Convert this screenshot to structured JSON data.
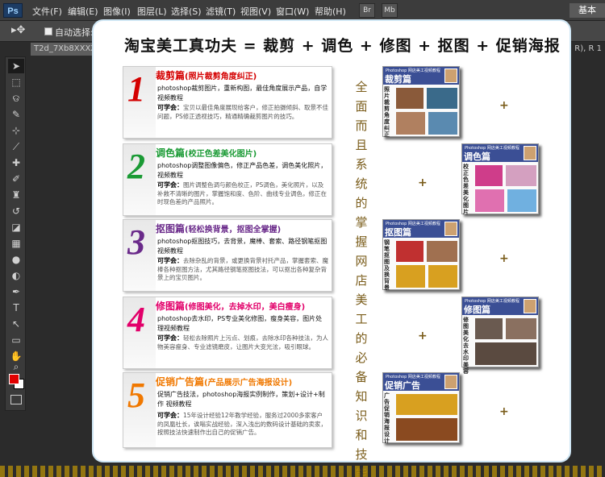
{
  "app": {
    "logo": "Ps",
    "menus": [
      "文件(F)",
      "编辑(E)",
      "图像(I)",
      "图层(L)",
      "选择(S)",
      "滤镜(T)",
      "视图(V)",
      "窗口(W)",
      "帮助(H)"
    ],
    "topright": [
      "Br",
      "Mb"
    ],
    "workspace": "基本"
  },
  "options": {
    "auto_select_label": "自动选择:"
  },
  "doc_tab": "T2d_7Xb8XXXXX",
  "right_panel_text": "R), R 1",
  "banner": {
    "title": "淘宝美工真功夫 = 裁剪 + 调色 + 修图 + 抠图 + 促销海报",
    "slogan": "全面而且系统的掌握网店美工的必备知识和技能",
    "plus": "+",
    "items": [
      {
        "num": "1",
        "color": "#d40000",
        "title": "裁剪篇",
        "sub": "(照片裁剪角度纠正)",
        "desc": "photoshop裁剪图片，重新构图，最佳角度展示产品，自学视频教程",
        "learn_label": "可学会：",
        "learn": "宝贝以最佳角度展现给客户，修正拍摄倾斜、取景不佳问题，PS修正透视技巧，精通精确裁剪图片的技巧。"
      },
      {
        "num": "2",
        "color": "#1a9a34",
        "title": "调色篇",
        "sub": "(校正色差美化图片)",
        "desc": "photoshop调整图像偏色，修正产品色差，调色美化照片，视频教程",
        "learn_label": "可学会：",
        "learn": "图片调整色调与颜色校正，PS调色，美化照片，以及补救不清晰的图片，掌握饱和度、色阶、曲线专业调色，修正在时现色差的产品照片。"
      },
      {
        "num": "3",
        "color": "#6a2a8a",
        "title": "抠图篇",
        "sub": "(轻松换背景，抠图全掌握)",
        "desc": "photoshop抠图技巧，去背景，魔棒、套索、路径钢笔抠图视频教程",
        "learn_label": "可学会：",
        "learn": "去除杂乱的背景，或更换背景衬托产品，掌握套索、魔棒各种抠图方法，尤其路径钢笔抠图技法，可以抠出各种复杂背景上的宝贝图片。"
      },
      {
        "num": "4",
        "color": "#e2006a",
        "title": "修图篇",
        "sub": "(修图美化，去掉水印，美白瘦身)",
        "desc": "photoshop去水印，PS专业美化修图，瘦身美容，图片处理视频教程",
        "learn_label": "可学会：",
        "learn": "轻松去除照片上污点、划痕，去除水印各种技法，为人物美容瘦身、专业滤镜磨皮，让图片大变光泫，吸引眼球。"
      },
      {
        "num": "5",
        "color": "#f07800",
        "title": "促销广告篇",
        "sub": "(产品展示广告海报设计)",
        "desc": "促销广告技法，photoshop海报实例制作，策划+设计+制作 视频教程",
        "learn_label": "可学会：",
        "learn": "15年设计经验12年教学经验，服务过2000多家客户的凤凰社长，诶嗡实战经验，深入浅出的数码设计基础的卖家，按照技法快速制作出自己的促销广告。"
      }
    ],
    "thumbs": [
      {
        "small": "Photoshop 网店美工视频教程",
        "name": "裁剪篇",
        "side": "照片裁剪角度纠正",
        "accent": "#7a4a2a"
      },
      {
        "small": "Photoshop 网店美工视频教程",
        "name": "调色篇",
        "side": "校正色差美化图片",
        "accent": "#cf3d8a"
      },
      {
        "small": "Photoshop 网店美工视频教程",
        "name": "抠图篇",
        "side": "钢笔抠图及换背景",
        "accent": "#d8a020"
      },
      {
        "small": "Photoshop 网店美工视频教程",
        "name": "修图篇",
        "side": "修图美化去水印美容",
        "accent": "#6a5a50"
      },
      {
        "small": "Photoshop 网店美工视频教程",
        "name": "促销广告",
        "side": "广告促销海报设计",
        "accent": "#b05a20"
      }
    ]
  }
}
